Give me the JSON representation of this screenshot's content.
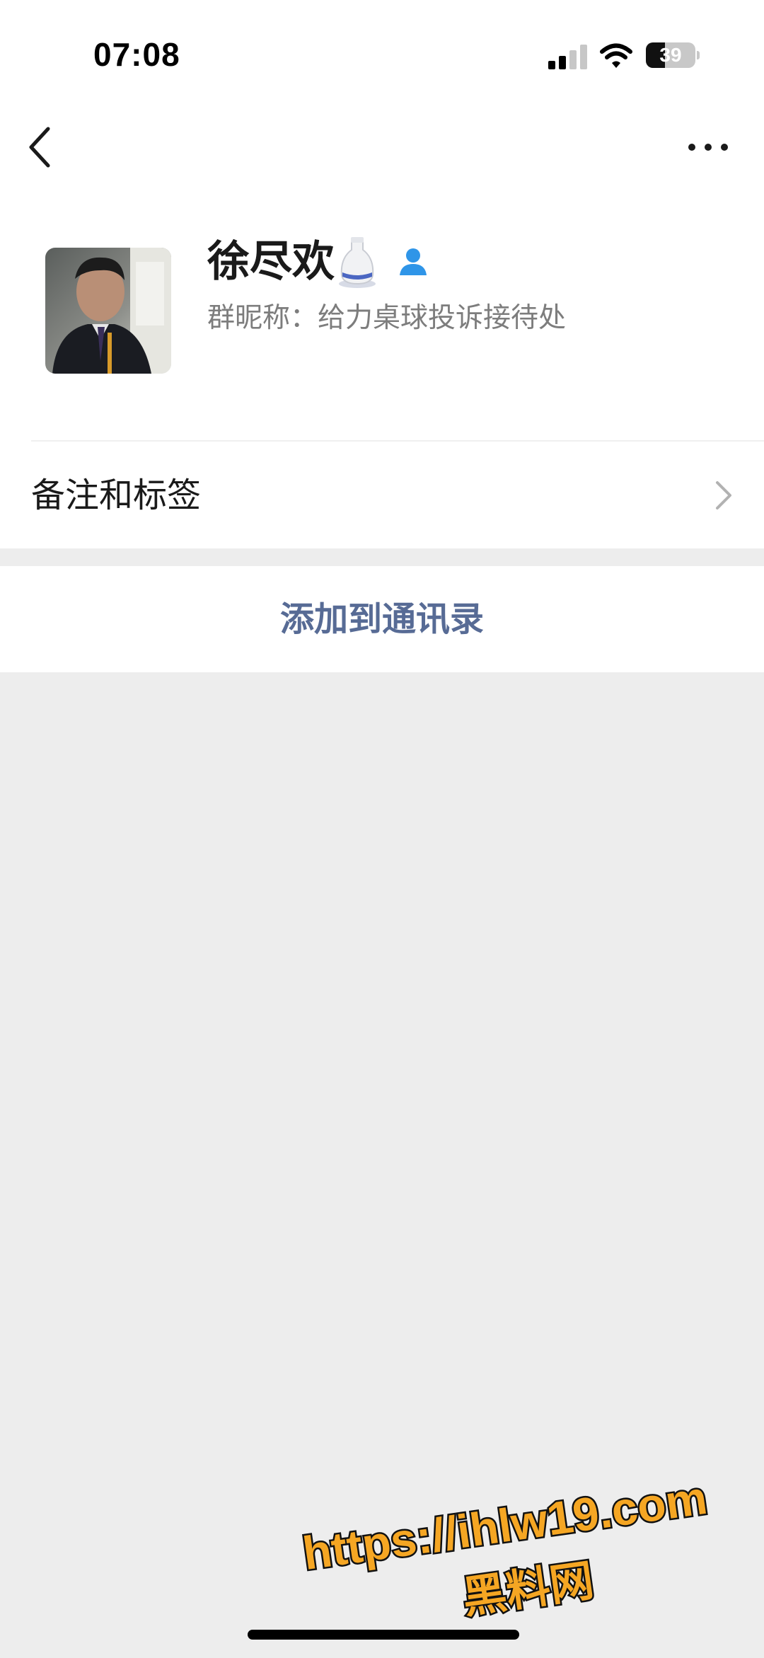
{
  "status_bar": {
    "time": "07:08",
    "battery_level": "39",
    "battery_fraction": 0.39,
    "signal_icon": "cellular-signal-icon",
    "wifi_icon": "wifi-icon"
  },
  "nav": {
    "back_icon": "chevron-left-icon",
    "more_icon": "more-dots-icon"
  },
  "profile": {
    "name": "徐尽欢",
    "name_emoji_icon": "sake-bottle-icon",
    "contact_badge_icon": "person-icon",
    "group_nickname": "群昵称：给力桌球投诉接待处"
  },
  "remarks": {
    "label": "备注和标签",
    "icon": "chevron-right-icon"
  },
  "actions": {
    "add_to_contacts": "添加到通讯录"
  },
  "watermark": {
    "line1": "https://ihlw19.com",
    "line2": "黑料网"
  },
  "colors": {
    "link_blue": "#576b95",
    "contact_badge_blue": "#2f95e8",
    "watermark_orange": "#f5a623",
    "background_gray": "#ededed"
  }
}
